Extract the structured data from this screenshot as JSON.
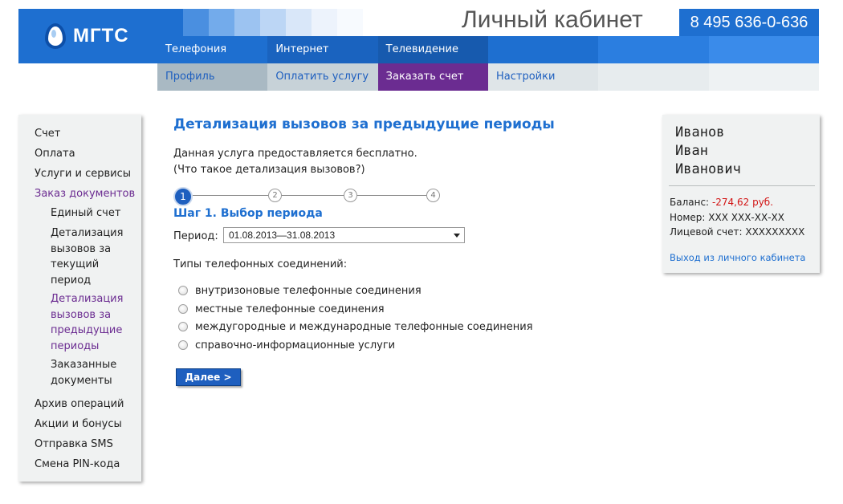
{
  "header": {
    "logo_text": "МГТС",
    "cabinet_title": "Личный кабинет",
    "phone": "8 495 636-0-636",
    "square_colors": [
      "#1e6fd0",
      "#4a8fe0",
      "#73abeb",
      "#9cc3f1",
      "#bcd6f5",
      "#d9e7f9",
      "#edf3fc",
      "#f7fafe",
      "#ffffff"
    ]
  },
  "nav_main": {
    "items": [
      {
        "label": "Телефония",
        "bg": "#1e6fd0"
      },
      {
        "label": "Интернет",
        "bg": "#1a63bf"
      },
      {
        "label": "Телевидение",
        "bg": "#175aae"
      },
      {
        "label": "",
        "bg": "#1e6fd0"
      },
      {
        "label": "",
        "bg": "#2b7ee0"
      },
      {
        "label": "",
        "bg": "#3a8bea"
      }
    ]
  },
  "nav_sub": {
    "items": [
      {
        "label": "Профиль",
        "bg": "#a9b9c3",
        "color": "#1e5fbf"
      },
      {
        "label": "Оплатить услугу",
        "bg": "#c7d2d8",
        "color": "#1e5fbf"
      },
      {
        "label": "Заказать счет",
        "bg": "#6b2c91",
        "color": "#ffffff"
      },
      {
        "label": "Настройки",
        "bg": "#dfe5e8",
        "color": "#1e5fbf"
      },
      {
        "label": "",
        "bg": "#e7ecee",
        "color": "#1e5fbf"
      },
      {
        "label": "",
        "bg": "#eef2f3",
        "color": "#1e5fbf"
      }
    ]
  },
  "sidebar": {
    "items": [
      "Счет",
      "Оплата",
      "Услуги и сервисы",
      "Заказ документов"
    ],
    "sub_items": [
      "Единый счет",
      "Детализация вызовов за текущий период",
      "Детализация вызовов за предыдущие периоды",
      "Заказанные документы"
    ],
    "items_after": [
      "Архив операций",
      "Акции и бонусы",
      "Отправка SMS",
      "Смена PIN-кода"
    ],
    "active_color": "#6b2c91"
  },
  "main": {
    "title": "Детализация вызовов за предыдущие периоды",
    "info_free": "Данная услуга предоставляется бесплатно.",
    "info_question": "(Что такое детализация вызовов?)",
    "steps": [
      "1",
      "2",
      "3",
      "4"
    ],
    "step_title": "Шаг 1. Выбор периода",
    "period_label": "Период:",
    "period_value": "01.08.2013—31.08.2013",
    "types_label": "Типы телефонных соединений:",
    "connection_types": [
      "внутризоновые телефонные соединения",
      "местные телефонные соединения",
      "междугородные и международные телефонные соединения",
      "справочно-информационные услуги"
    ],
    "next_button": "Далее >"
  },
  "user": {
    "last_name": "Иванов",
    "first_name": "Иван",
    "patronymic": "Иванович",
    "balance_label": "Баланс:",
    "balance_value": "-274,62 руб.",
    "number_label": "Номер:",
    "number_value": "ХХХ ХХХ-ХХ-ХХ",
    "account_label": "Лицевой счет:",
    "account_value": "ХХХХХХХХХ",
    "logout": "Выход из личного кабинета"
  }
}
